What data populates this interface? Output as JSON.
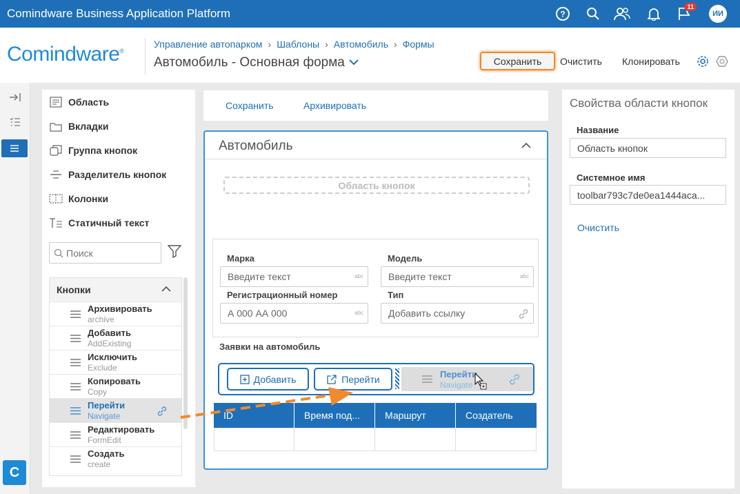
{
  "topbar": {
    "title": "Comindware Business Application Platform",
    "notifications_count": "11",
    "user_initials": "ИИ",
    "icons": [
      "help-icon",
      "search-icon",
      "users-icon",
      "bell-icon",
      "flag-icon"
    ]
  },
  "header": {
    "logo_text": "Comindware",
    "logo_reg": "®",
    "breadcrumb": [
      "Управление автопарком",
      "Шаблоны",
      "Автомобиль",
      "Формы"
    ],
    "page_title": "Автомобиль - Основная форма",
    "actions": {
      "save": "Сохранить",
      "clear": "Очистить",
      "clone": "Клонировать"
    }
  },
  "palette": {
    "items": [
      {
        "label": "Область",
        "icon": "area-icon"
      },
      {
        "label": "Вкладки",
        "icon": "tabs-icon"
      },
      {
        "label": "Группа кнопок",
        "icon": "button-group-icon"
      },
      {
        "label": "Разделитель кнопок",
        "icon": "button-separator-icon"
      },
      {
        "label": "Колонки",
        "icon": "columns-icon"
      },
      {
        "label": "Статичный текст",
        "icon": "static-text-icon"
      }
    ],
    "search_placeholder": "Поиск",
    "group_title": "Кнопки",
    "buttons": [
      {
        "name": "Архивировать",
        "sys": "archive"
      },
      {
        "name": "Добавить",
        "sys": "AddExisting"
      },
      {
        "name": "Исключить",
        "sys": "Exclude"
      },
      {
        "name": "Копировать",
        "sys": "Copy"
      },
      {
        "name": "Перейти",
        "sys": "Navigate",
        "selected": true
      },
      {
        "name": "Редактировать",
        "sys": "FormEdit"
      },
      {
        "name": "Создать",
        "sys": "create"
      }
    ]
  },
  "toolbar": {
    "save": "Сохранить",
    "archive": "Архивировать"
  },
  "form": {
    "title": "Автомобиль",
    "button_area_placeholder": "Область кнопок",
    "fields": {
      "brand_label": "Марка",
      "brand_placeholder": "Введите текст",
      "model_label": "Модель",
      "model_placeholder": "Введите текст",
      "reg_label": "Регистрационный номер",
      "reg_placeholder": "А 000 АА 000",
      "type_label": "Тип",
      "type_placeholder": "Добавить ссылку",
      "abc": "abc"
    },
    "subtable_title": "Заявки на автомобиль",
    "subtable_buttons": {
      "add": "Добавить",
      "navigate": "Перейти"
    },
    "dragged": {
      "name": "Перейти",
      "sys": "Navigate"
    },
    "columns": [
      "ID",
      "Время под...",
      "Маршрут",
      "Создатель"
    ]
  },
  "props": {
    "title": "Свойства области кнопок",
    "name_label": "Название",
    "name_value": "Область кнопок",
    "sysname_label": "Системное имя",
    "sysname_value": "toolbar793c7de0ea1444aca...",
    "clear_link": "Очистить"
  },
  "colors": {
    "brand": "#1e6fb8",
    "highlight": "#f08a2c"
  }
}
